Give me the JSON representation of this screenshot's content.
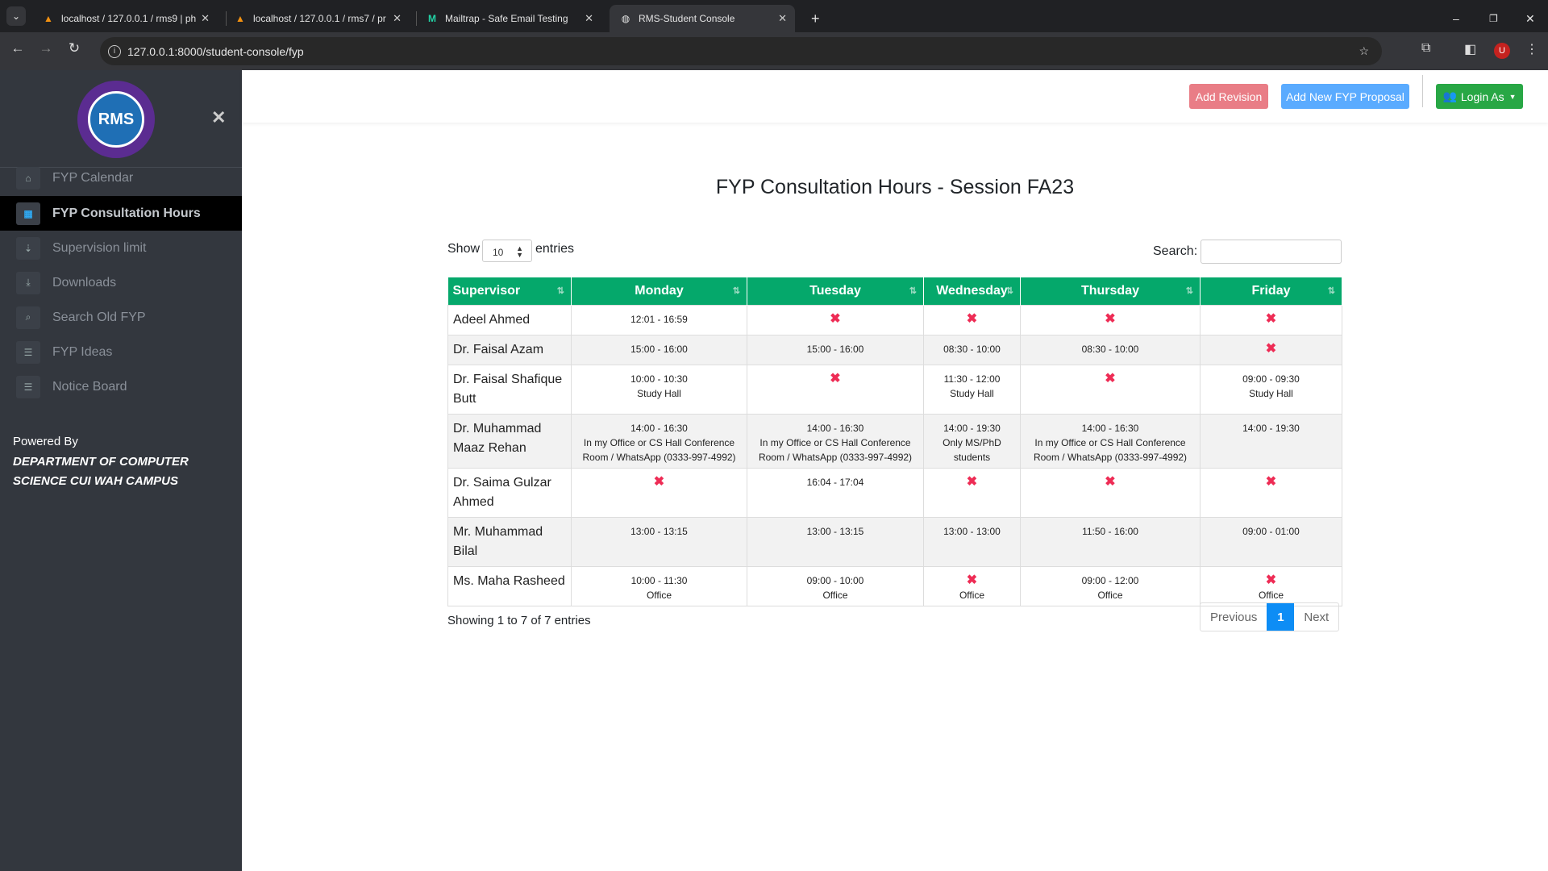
{
  "browser": {
    "tabs": [
      {
        "title": "localhost / 127.0.0.1 / rms9 | ph",
        "icon": "phpmyadmin-icon"
      },
      {
        "title": "localhost / 127.0.0.1 / rms7 / pr",
        "icon": "phpmyadmin-icon"
      },
      {
        "title": "Mailtrap - Safe Email Testing",
        "icon": "mailtrap-icon"
      },
      {
        "title": "RMS-Student Console",
        "icon": "globe-icon",
        "active": true
      }
    ],
    "url": "127.0.0.1:8000/student-console/fyp",
    "profile_initial": "U"
  },
  "sidebar": {
    "logo_text": "RMS",
    "logo_ring_text": "COMSATS UNIVERSITY ISLAMABAD WAH CAMPUS",
    "items": [
      {
        "label": "FYP Calendar",
        "icon": "home-icon"
      },
      {
        "label": "FYP Consultation Hours",
        "icon": "calendar-icon",
        "active": true
      },
      {
        "label": "Supervision limit",
        "icon": "sort-amount-icon"
      },
      {
        "label": "Downloads",
        "icon": "download-icon"
      },
      {
        "label": "Search Old FYP",
        "icon": "search-icon"
      },
      {
        "label": "FYP Ideas",
        "icon": "list-icon"
      },
      {
        "label": "Notice Board",
        "icon": "list-icon"
      }
    ],
    "powered_by": "Powered By",
    "department": "DEPARTMENT OF COMPUTER SCIENCE CUI WAH CAMPUS"
  },
  "topnav": {
    "add_revision": "Add Revision",
    "add_proposal": "Add New FYP Proposal",
    "login_as": "Login As"
  },
  "colors": {
    "header_green": "#05a86b",
    "add_revision": "#e97d86",
    "add_proposal": "#5aabff",
    "login": "#28a745",
    "x_mark": "#ee2c55",
    "page_active": "#0d8df5"
  },
  "page": {
    "title": "FYP Consultation Hours - Session FA23",
    "show_label": "Show",
    "entries_value": "10",
    "entries_label": "entries",
    "search_label": "Search:",
    "search_value": "",
    "showing": "Showing 1 to 7 of 7 entries",
    "pagination": {
      "previous": "Previous",
      "current": "1",
      "next": "Next"
    }
  },
  "table": {
    "columns": [
      "Supervisor",
      "Monday",
      "Tuesday",
      "Wednesday",
      "Thursday",
      "Friday"
    ],
    "rows": [
      {
        "supervisor": "Adeel Ahmed",
        "days": [
          {
            "time": "12:01 - 16:59"
          },
          {
            "x": true
          },
          {
            "x": true
          },
          {
            "x": true
          },
          {
            "x": true
          }
        ]
      },
      {
        "supervisor": "Dr. Faisal Azam",
        "days": [
          {
            "time": "15:00 - 16:00"
          },
          {
            "time": "15:00 - 16:00"
          },
          {
            "time": "08:30 - 10:00"
          },
          {
            "time": "08:30 - 10:00"
          },
          {
            "x": true
          }
        ]
      },
      {
        "supervisor": "Dr. Faisal Shafique Butt",
        "days": [
          {
            "time": "10:00 - 10:30",
            "note": "Study Hall"
          },
          {
            "x": true
          },
          {
            "time": "11:30 - 12:00",
            "note": "Study Hall"
          },
          {
            "x": true
          },
          {
            "time": "09:00 - 09:30",
            "note": "Study Hall"
          }
        ]
      },
      {
        "supervisor": "Dr. Muhammad Maaz Rehan",
        "days": [
          {
            "time": "14:00 - 16:30",
            "note": "In my Office or CS Hall Conference Room / WhatsApp (0333-997-4992)"
          },
          {
            "time": "14:00 - 16:30",
            "note": "In my Office or CS Hall Conference Room / WhatsApp (0333-997-4992)"
          },
          {
            "time": "14:00 - 19:30",
            "note": "Only MS/PhD students"
          },
          {
            "time": "14:00 - 16:30",
            "note": "In my Office or CS Hall Conference Room / WhatsApp (0333-997-4992)"
          },
          {
            "time": "14:00 - 19:30"
          }
        ]
      },
      {
        "supervisor": "Dr. Saima Gulzar Ahmed",
        "days": [
          {
            "x": true
          },
          {
            "time": "16:04 - 17:04"
          },
          {
            "x": true
          },
          {
            "x": true
          },
          {
            "x": true
          }
        ]
      },
      {
        "supervisor": "Mr. Muhammad Bilal",
        "days": [
          {
            "time": "13:00 - 13:15"
          },
          {
            "time": "13:00 - 13:15"
          },
          {
            "time": "13:00 - 13:00"
          },
          {
            "time": "11:50 - 16:00"
          },
          {
            "time": "09:00 - 01:00"
          }
        ]
      },
      {
        "supervisor": "Ms. Maha Rasheed",
        "days": [
          {
            "time": "10:00 - 11:30",
            "note": "Office"
          },
          {
            "time": "09:00 - 10:00",
            "note": "Office"
          },
          {
            "x": true,
            "note": "Office"
          },
          {
            "time": "09:00 - 12:00",
            "note": "Office"
          },
          {
            "x": true,
            "note": "Office"
          }
        ]
      }
    ]
  }
}
